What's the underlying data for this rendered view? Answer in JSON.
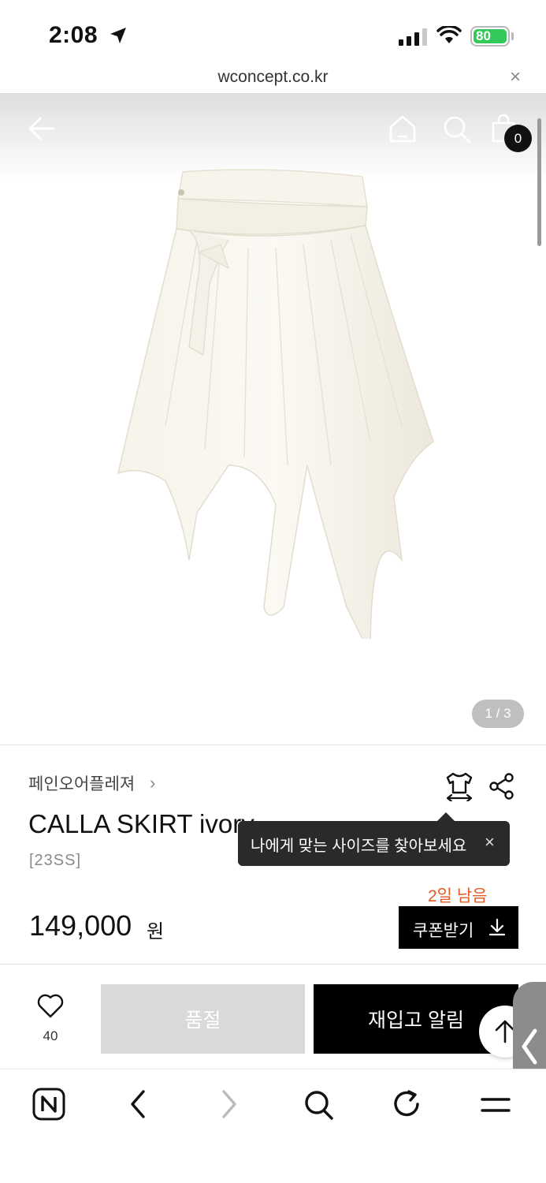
{
  "status_bar": {
    "time": "2:08",
    "battery": "80"
  },
  "browser": {
    "url": "wconcept.co.kr",
    "close_label": "×"
  },
  "header": {
    "cart_count": "0"
  },
  "gallery": {
    "counter": "1 / 3"
  },
  "product": {
    "brand": "페인오어플레져",
    "brand_chevron": "›",
    "title": "CALLA SKIRT ivory",
    "season": "[23SS]",
    "price": "149,000",
    "price_unit": "원",
    "days_left": "2일 남음",
    "coupon_label": "쿠폰받기"
  },
  "tooltip": {
    "text": "나에게 맞는 사이즈를 찾아보세요",
    "close": "×"
  },
  "actions": {
    "wish_count": "40",
    "soldout_label": "품절",
    "restock_label": "재입고 알림"
  },
  "colors": {
    "accent_orange": "#e05a24",
    "black": "#000000",
    "soldout_gray": "#d9d9d9"
  },
  "icons": [
    "back-arrow-icon",
    "home-icon",
    "search-icon",
    "bag-icon",
    "size-guide-icon",
    "share-icon",
    "heart-icon",
    "arrow-up-icon",
    "download-icon",
    "naver-icon",
    "refresh-icon",
    "menu-icon"
  ]
}
